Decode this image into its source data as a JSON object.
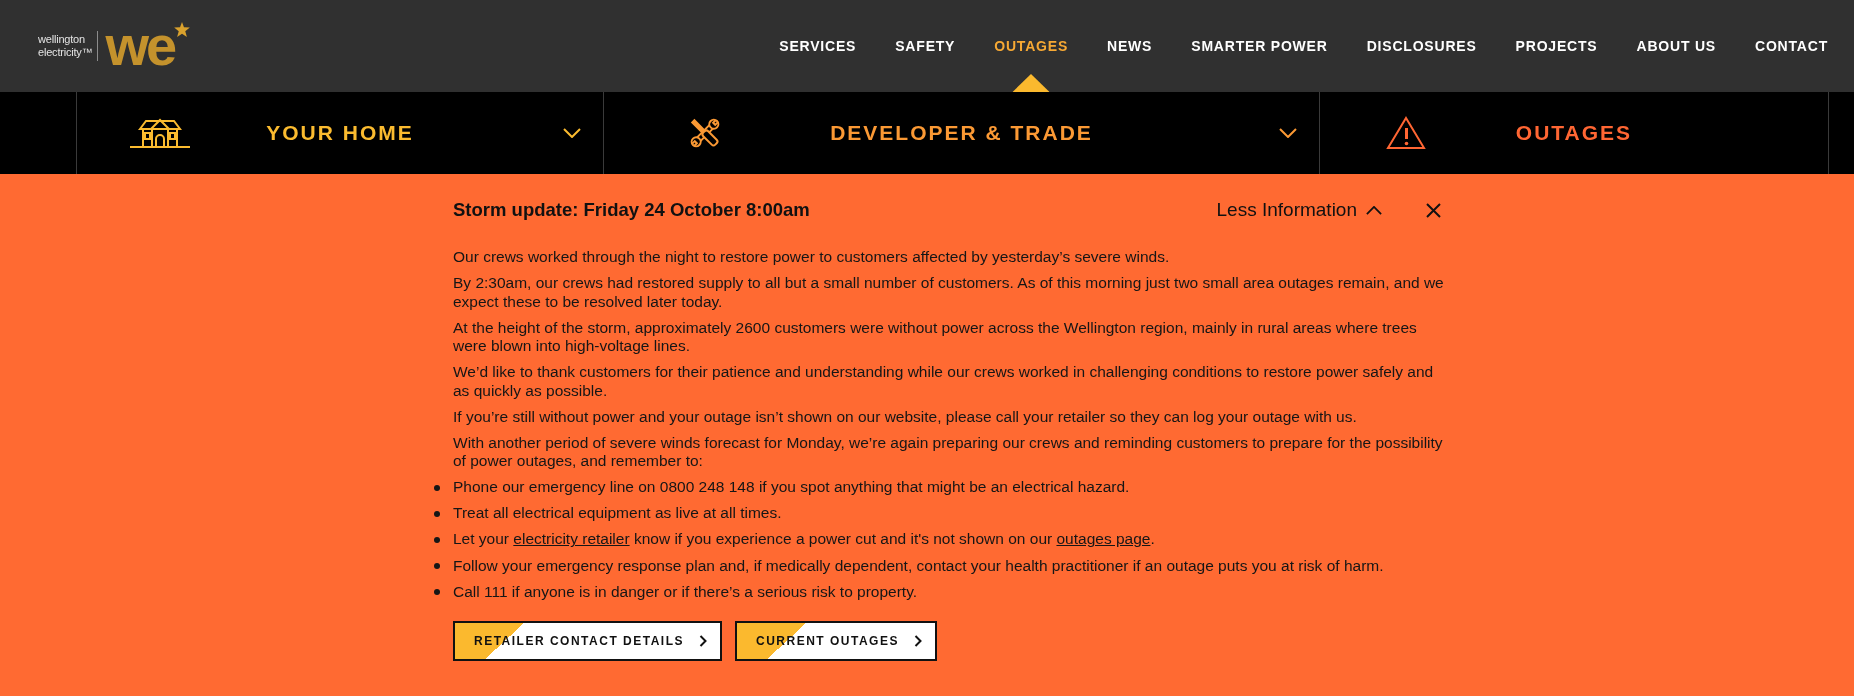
{
  "header": {
    "logo": {
      "wordmark": [
        "wellington",
        "electricity™"
      ],
      "monogram": "we"
    },
    "nav": [
      {
        "label": "SERVICES",
        "selected": false
      },
      {
        "label": "SAFETY",
        "selected": false
      },
      {
        "label": "OUTAGES",
        "selected": true
      },
      {
        "label": "NEWS",
        "selected": false
      },
      {
        "label": "SMARTER POWER",
        "selected": false
      },
      {
        "label": "DISCLOSURES",
        "selected": false
      },
      {
        "label": "PROJECTS",
        "selected": false
      },
      {
        "label": "ABOUT US",
        "selected": false
      },
      {
        "label": "CONTACT",
        "selected": false
      }
    ]
  },
  "section_nav": [
    {
      "label": "YOUR HOME",
      "color": "#fbbb2f",
      "dropdown": true
    },
    {
      "label": "DEVELOPER & TRADE",
      "color": "#fb9934",
      "dropdown": true
    },
    {
      "label": "OUTAGES",
      "color": "#ff6633",
      "dropdown": false
    }
  ],
  "alert": {
    "title": "Storm update: Friday 24 October 8:00am",
    "toggle": "Less Information",
    "expanded": true,
    "paragraphs": [
      "Our crews worked through the night to restore power to customers affected by yesterday’s severe winds.",
      "By 2:30am, our crews had restored supply to all but a small number of customers. As of this morning just two small area outages remain, and we expect these to be resolved later today.",
      "At the height of the storm, approximately 2600 customers were without power across the Wellington region, mainly in rural areas where trees were blown into high-voltage lines.",
      "We’d like to thank customers for their patience and understanding while our crews worked in challenging conditions to restore power safely and as quickly as possible.",
      "If you’re still without power and your outage isn’t shown on our website, please call your retailer so they can log your outage with us.",
      "With another period of severe winds forecast for Monday, we’re again preparing our crews and reminding customers to prepare for the possibility of power outages, and remember to:"
    ],
    "bullets": [
      {
        "segments": [
          {
            "kind": "text",
            "text": "Phone our emergency line on 0800 248 148 if you spot anything that might be an electrical hazard."
          }
        ]
      },
      {
        "segments": [
          {
            "kind": "text",
            "text": "Treat all electrical equipment as live at all times."
          }
        ]
      },
      {
        "segments": [
          {
            "kind": "text",
            "text": "Let your "
          },
          {
            "kind": "link",
            "text": "electricity retailer"
          },
          {
            "kind": "text",
            "text": " know if you experience a power cut and it's not shown on our "
          },
          {
            "kind": "link",
            "text": "outages page"
          },
          {
            "kind": "text",
            "text": "."
          }
        ]
      },
      {
        "segments": [
          {
            "kind": "text",
            "text": "Follow your emergency response plan and, if medically dependent, contact your health practitioner if an outage puts you at risk of harm."
          }
        ]
      },
      {
        "segments": [
          {
            "kind": "text",
            "text": "Call 111 if anyone is in danger or if there’s a serious risk to property."
          }
        ]
      }
    ],
    "buttons": [
      "RETAILER CONTACT DETAILS",
      "CURRENT OUTAGES"
    ]
  }
}
